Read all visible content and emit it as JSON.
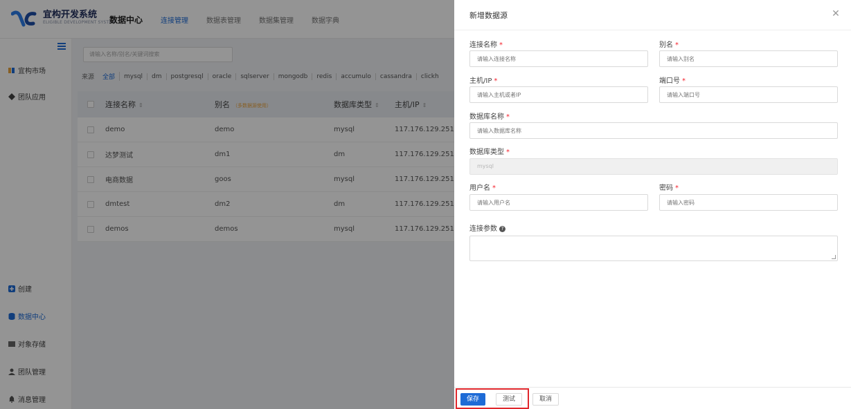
{
  "app": {
    "title": "宜构开发系统",
    "subtitle": "ELIGIBLE DEVELOPMENT SYSTEM"
  },
  "topnav": {
    "brand": "数据中心",
    "items": [
      "连接管理",
      "数据表管理",
      "数据集管理",
      "数据字典"
    ]
  },
  "sidebar": {
    "top_items": [
      "宜构市场",
      "团队应用"
    ],
    "bottom_items": [
      "创建",
      "数据中心",
      "对象存储",
      "团队管理",
      "消息管理"
    ]
  },
  "main": {
    "search_placeholder": "请输入名称/别名/关键词搜索",
    "filter_label": "来源",
    "filters": [
      "全部",
      "mysql",
      "dm",
      "postgresql",
      "oracle",
      "sqlserver",
      "mongodb",
      "redis",
      "accumulo",
      "cassandra",
      "clickh"
    ],
    "columns": {
      "name": "连接名称",
      "alias": "别名",
      "alias_hint": "（多数据源使用）",
      "type": "数据库类型",
      "host": "主机/IP"
    },
    "rows": [
      {
        "name": "demo",
        "alias": "demo",
        "type": "mysql",
        "host": "117.176.129.251"
      },
      {
        "name": "达梦测试",
        "alias": "dm1",
        "type": "dm",
        "host": "117.176.129.251"
      },
      {
        "name": "电商数据",
        "alias": "goos",
        "type": "mysql",
        "host": "117.176.129.251"
      },
      {
        "name": "dmtest",
        "alias": "dm2",
        "type": "dm",
        "host": "117.176.129.251"
      },
      {
        "name": "demos",
        "alias": "demos",
        "type": "mysql",
        "host": "117.176.129.251"
      }
    ]
  },
  "drawer": {
    "title": "新增数据源",
    "fields": {
      "conn_name": {
        "label": "连接名称",
        "placeholder": "请输入连接名称"
      },
      "alias": {
        "label": "别名",
        "placeholder": "请输入别名"
      },
      "host": {
        "label": "主机/IP",
        "placeholder": "请输入主机或者IP"
      },
      "port": {
        "label": "端口号",
        "placeholder": "请输入端口号"
      },
      "db_name": {
        "label": "数据库名称",
        "placeholder": "请输入数据库名称"
      },
      "db_type": {
        "label": "数据库类型",
        "value": "mysql"
      },
      "username": {
        "label": "用户名",
        "placeholder": "请输入用户名"
      },
      "password": {
        "label": "密码",
        "placeholder": "请输入密码"
      },
      "params": {
        "label": "连接参数"
      }
    },
    "required_mark": "*",
    "buttons": {
      "save": "保存",
      "test": "测试",
      "cancel": "取消"
    }
  },
  "colors": {
    "primary": "#1e6bd6",
    "required": "#f5222d",
    "highlight": "#e0262b"
  }
}
